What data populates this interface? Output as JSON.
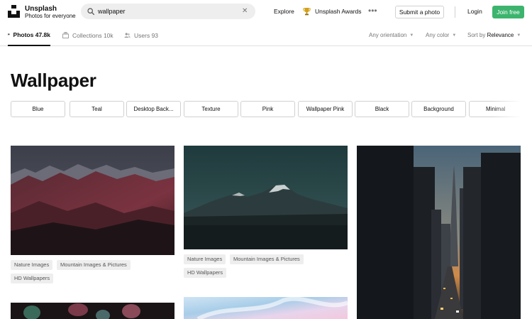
{
  "header": {
    "brand_name": "Unsplash",
    "brand_tagline": "Photos for everyone",
    "search_value": "wallpaper",
    "explore": "Explore",
    "awards": "Unsplash Awards",
    "submit": "Submit a photo",
    "login": "Login",
    "join": "Join free",
    "accent_color": "#3cb46e"
  },
  "tabs": [
    {
      "label": "Photos",
      "count": "47.8k",
      "icon": "photo-icon",
      "active": true
    },
    {
      "label": "Collections",
      "count": "10k",
      "icon": "collections-icon",
      "active": false
    },
    {
      "label": "Users",
      "count": "93",
      "icon": "users-icon",
      "active": false
    }
  ],
  "filters": {
    "orientation": "Any orientation",
    "color": "Any color",
    "sort_prefix": "Sort by",
    "sort_value": "Relevance"
  },
  "title": "Wallpaper",
  "related": [
    "Blue",
    "Teal",
    "Desktop Back...",
    "Texture",
    "Pink",
    "Wallpaper Pink",
    "Black",
    "Background",
    "Minimal"
  ],
  "photos": {
    "col1": {
      "subject": "red-mountain-range",
      "tags": [
        "Nature Images",
        "Mountain Images & Pictures",
        "HD Wallpapers"
      ]
    },
    "col2": {
      "subject": "teal-mountain-peak",
      "tags": [
        "Nature Images",
        "Mountain Images & Pictures",
        "HD Wallpapers"
      ]
    },
    "col3": {
      "subject": "city-street-sunset"
    }
  }
}
